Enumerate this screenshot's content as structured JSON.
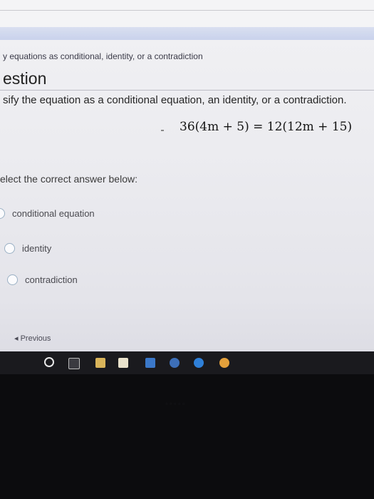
{
  "header": {
    "breadcrumb": "y equations as conditional, identity, or a contradiction",
    "section_title": "estion"
  },
  "question": {
    "instruction": "sify the equation as a conditional equation, an identity, or a contradiction.",
    "equation": "36(4m + 5) = 12(12m + 15)",
    "prompt": "elect the correct answer below:"
  },
  "options": [
    {
      "label": "conditional equation"
    },
    {
      "label": "identity"
    },
    {
      "label": "contradiction"
    }
  ],
  "nav": {
    "previous_label": "Previous",
    "previous_icon": "◂"
  },
  "taskbar": {
    "icons": [
      "start-icon",
      "task-view-icon",
      "file-explorer-icon",
      "store-icon",
      "mail-icon",
      "media-icon",
      "edge-icon",
      "chrome-icon"
    ]
  },
  "colors": {
    "screen_bg": "#ececf0",
    "accent_bar": "#c9d2ec",
    "taskbar": "#1a1a1e"
  }
}
